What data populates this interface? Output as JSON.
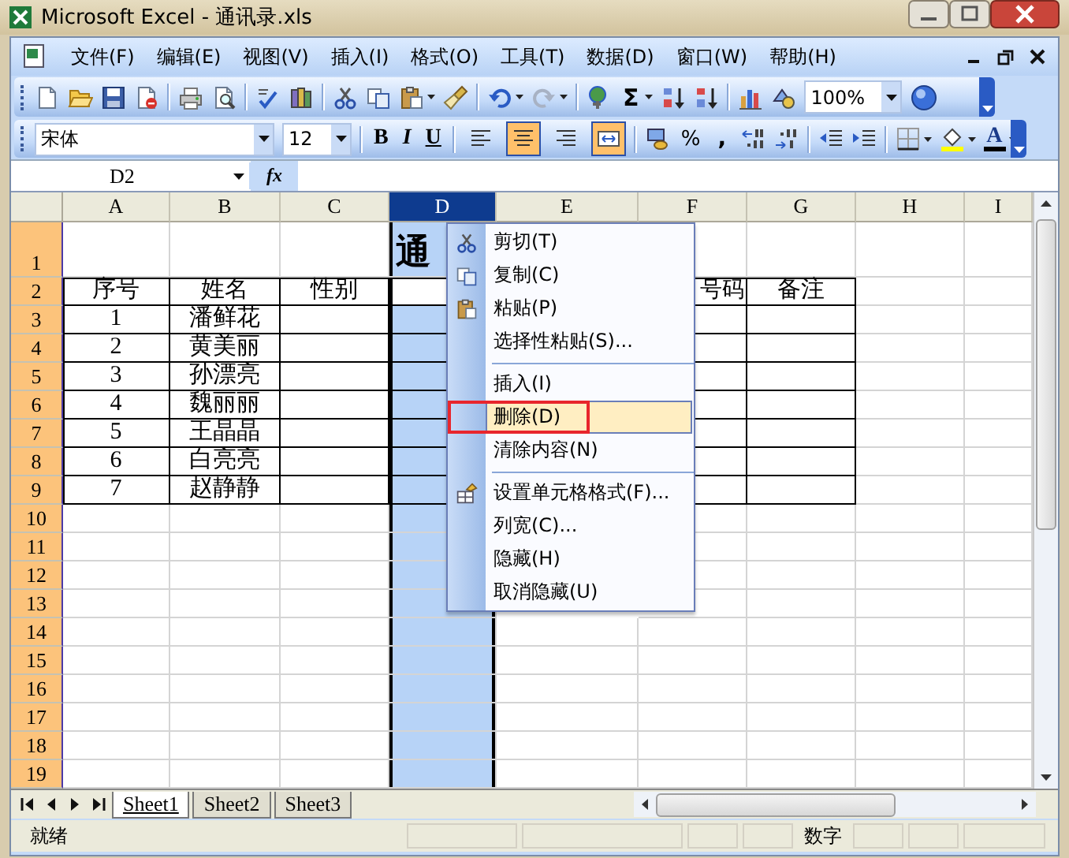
{
  "window": {
    "title": "Microsoft Excel - 通讯录.xls"
  },
  "menu_bar": [
    "文件(F)",
    "编辑(E)",
    "视图(V)",
    "插入(I)",
    "格式(O)",
    "工具(T)",
    "数据(D)",
    "窗口(W)",
    "帮助(H)"
  ],
  "standard_toolbar": {
    "sum": "Σ",
    "zoom": "100%"
  },
  "formatting_toolbar": {
    "font": "宋体",
    "font_size": "12",
    "bold": "B",
    "italic": "I",
    "underline": "U",
    "percent": "%",
    "comma": ",",
    "font_color": "A",
    "alignment": [
      {
        "kind": "left",
        "selected": false
      },
      {
        "kind": "center",
        "selected": true
      },
      {
        "kind": "right",
        "selected": false
      },
      {
        "kind": "merge",
        "selected": true
      }
    ]
  },
  "formula_bar": {
    "name_box": "D2",
    "function_label": "fx"
  },
  "sheet": {
    "columns": [
      {
        "label": "A",
        "selected": false
      },
      {
        "label": "B",
        "selected": false
      },
      {
        "label": "C",
        "selected": false
      },
      {
        "label": "D",
        "selected": true
      },
      {
        "label": "E",
        "selected": false
      },
      {
        "label": "F",
        "selected": false
      },
      {
        "label": "G",
        "selected": false
      },
      {
        "label": "H",
        "selected": false
      },
      {
        "label": "I",
        "selected": false
      }
    ],
    "rows": [
      {
        "header": "1",
        "selected": true,
        "kind": "title",
        "bordered": false,
        "active": false,
        "cells": [
          null,
          null,
          null,
          "通"
        ]
      },
      {
        "header": "2",
        "selected": true,
        "kind": "data",
        "bordered": true,
        "active": true,
        "cells": [
          "序号",
          "姓名",
          "性别",
          null,
          null,
          "号码",
          "备注"
        ]
      },
      {
        "header": "3",
        "selected": true,
        "kind": "data",
        "bordered": true,
        "active": false,
        "cells": [
          "1",
          "潘鲜花"
        ]
      },
      {
        "header": "4",
        "selected": true,
        "kind": "data",
        "bordered": true,
        "active": false,
        "cells": [
          "2",
          "黄美丽"
        ]
      },
      {
        "header": "5",
        "selected": true,
        "kind": "data",
        "bordered": true,
        "active": false,
        "cells": [
          "3",
          "孙漂亮"
        ]
      },
      {
        "header": "6",
        "selected": true,
        "kind": "data",
        "bordered": true,
        "active": false,
        "cells": [
          "4",
          "魏丽丽"
        ]
      },
      {
        "header": "7",
        "selected": true,
        "kind": "data",
        "bordered": true,
        "active": false,
        "cells": [
          "5",
          "王晶晶"
        ]
      },
      {
        "header": "8",
        "selected": true,
        "kind": "data",
        "bordered": true,
        "active": false,
        "cells": [
          "6",
          "白亮亮"
        ]
      },
      {
        "header": "9",
        "selected": true,
        "kind": "data",
        "bordered": true,
        "active": false,
        "cells": [
          "7",
          "赵静静"
        ]
      },
      {
        "header": "10",
        "selected": true,
        "kind": "data",
        "bordered": false,
        "active": false,
        "cells": []
      },
      {
        "header": "11",
        "selected": true,
        "kind": "data",
        "bordered": false,
        "active": false,
        "cells": []
      },
      {
        "header": "12",
        "selected": true,
        "kind": "data",
        "bordered": false,
        "active": false,
        "cells": []
      },
      {
        "header": "13",
        "selected": true,
        "kind": "data",
        "bordered": false,
        "active": false,
        "cells": []
      },
      {
        "header": "14",
        "selected": true,
        "kind": "data",
        "bordered": false,
        "active": false,
        "cells": []
      },
      {
        "header": "15",
        "selected": true,
        "kind": "data",
        "bordered": false,
        "active": false,
        "cells": []
      },
      {
        "header": "16",
        "selected": true,
        "kind": "data",
        "bordered": false,
        "active": false,
        "cells": []
      },
      {
        "header": "17",
        "selected": true,
        "kind": "data",
        "bordered": false,
        "active": false,
        "cells": []
      },
      {
        "header": "18",
        "selected": true,
        "kind": "data",
        "bordered": false,
        "active": false,
        "cells": []
      },
      {
        "header": "19",
        "selected": true,
        "kind": "data",
        "bordered": false,
        "active": false,
        "cells": []
      }
    ]
  },
  "context_menu": {
    "groups": [
      [
        {
          "label": "剪切(T)",
          "kind": "cut",
          "selected": false
        },
        {
          "label": "复制(C)",
          "kind": "copy",
          "selected": false
        },
        {
          "label": "粘贴(P)",
          "kind": "paste",
          "selected": false
        },
        {
          "label": "选择性粘贴(S)...",
          "kind": "plain",
          "selected": false
        }
      ],
      [
        {
          "label": "插入(I)",
          "kind": "plain",
          "selected": false
        },
        {
          "label": "删除(D)",
          "kind": "plain",
          "selected": true
        },
        {
          "label": "清除内容(N)",
          "kind": "plain",
          "selected": false
        }
      ],
      [
        {
          "label": "设置单元格格式(F)...",
          "kind": "format",
          "selected": false
        },
        {
          "label": "列宽(C)...",
          "kind": "plain",
          "selected": false
        },
        {
          "label": "隐藏(H)",
          "kind": "plain",
          "selected": false
        },
        {
          "label": "取消隐藏(U)",
          "kind": "plain",
          "selected": false
        }
      ]
    ]
  },
  "sheet_tabs": [
    {
      "label": "Sheet1",
      "selected": true
    },
    {
      "label": "Sheet2",
      "selected": false
    },
    {
      "label": "Sheet3",
      "selected": false
    }
  ],
  "status_bar": {
    "mode": "就绪",
    "indicator": "数字"
  }
}
